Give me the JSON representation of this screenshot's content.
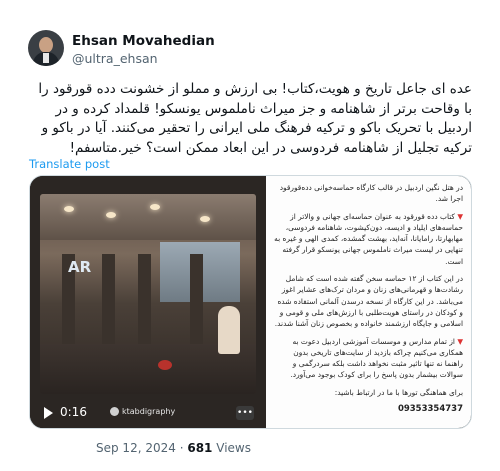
{
  "author": {
    "name": "Ehsan Movahedian",
    "handle": "@ultra_ehsan"
  },
  "tweet": {
    "text": "عده ای جاعل تاریخ و هویت،کتاب! بی ارزش و مملو از خشونت دده قورقود را با وقاحت برتر از شاهنامه و جز میراث ناملموس یونسکو! قلمداد کرده و در اردبیل با تحریک باکو و ترکیه فرهنگ ملی ایرانی را تحقیر می‌کنند. آیا در باکو و ترکیه تجلیل از شاهنامه فردوسی در این ابعاد ممکن است؟ خیر.متاسفم!",
    "translate_label": "Translate post",
    "date": "Sep 12, 2024",
    "separator": "·",
    "views_count": "681",
    "views_label": "Views"
  },
  "video": {
    "time": "0:16",
    "channel": "ktabdigraphy",
    "watermark": "AR"
  },
  "document": {
    "intro": "در هتل نگین اردبیل در قالب کارگاه حماسه‌خوانی دده‌قورقود اجرا شد.",
    "para1": "کتاب دده قورقود به عنوان حماسه‌ای جهانی و والاتر از حماسه‌های ایلیاد و ادیسه، دون‌کیشوت، شاهنامه فردوسی، مهابهارتا، رامایانا، آنه‌اید، بهشت گمشده، کمدی الهی و غیره به تنهایی در لیست میراث ناملموس جهانی یونسکو قرار گرفته است.",
    "para2": "در این کتاب از ۱۲ حماسه سخن گفته شده است که شامل رشادت‌ها و قهرمانی‌های زنان و مردان ترک‌های عشایر اغوز می‌باشد. در این کارگاه از نسخه درسدن آلمانی استفاده شده و کودکان در راستای هویت‌طلبی با ارزش‌های ملی و قومی و اسلامی و جایگاه ارزشمند خانواده و بخصوص زنان آشنا شدند.",
    "para3": "از تمام مدارس و موسسات آموزشی اردبیل دعوت به همکاری می‌کنیم چراکه بازدید از سایت‌های تاریخی بدون راهنما نه تنها تاثیر مثبت نخواهد داشت بلکه سردرگمی و سوالات بیشمار بدون پاسخ را برای کودک بوجود می‌آورد.",
    "contact": "برای هماهنگی تورها با ما در ارتباط باشید:",
    "phone": "09353354737"
  }
}
